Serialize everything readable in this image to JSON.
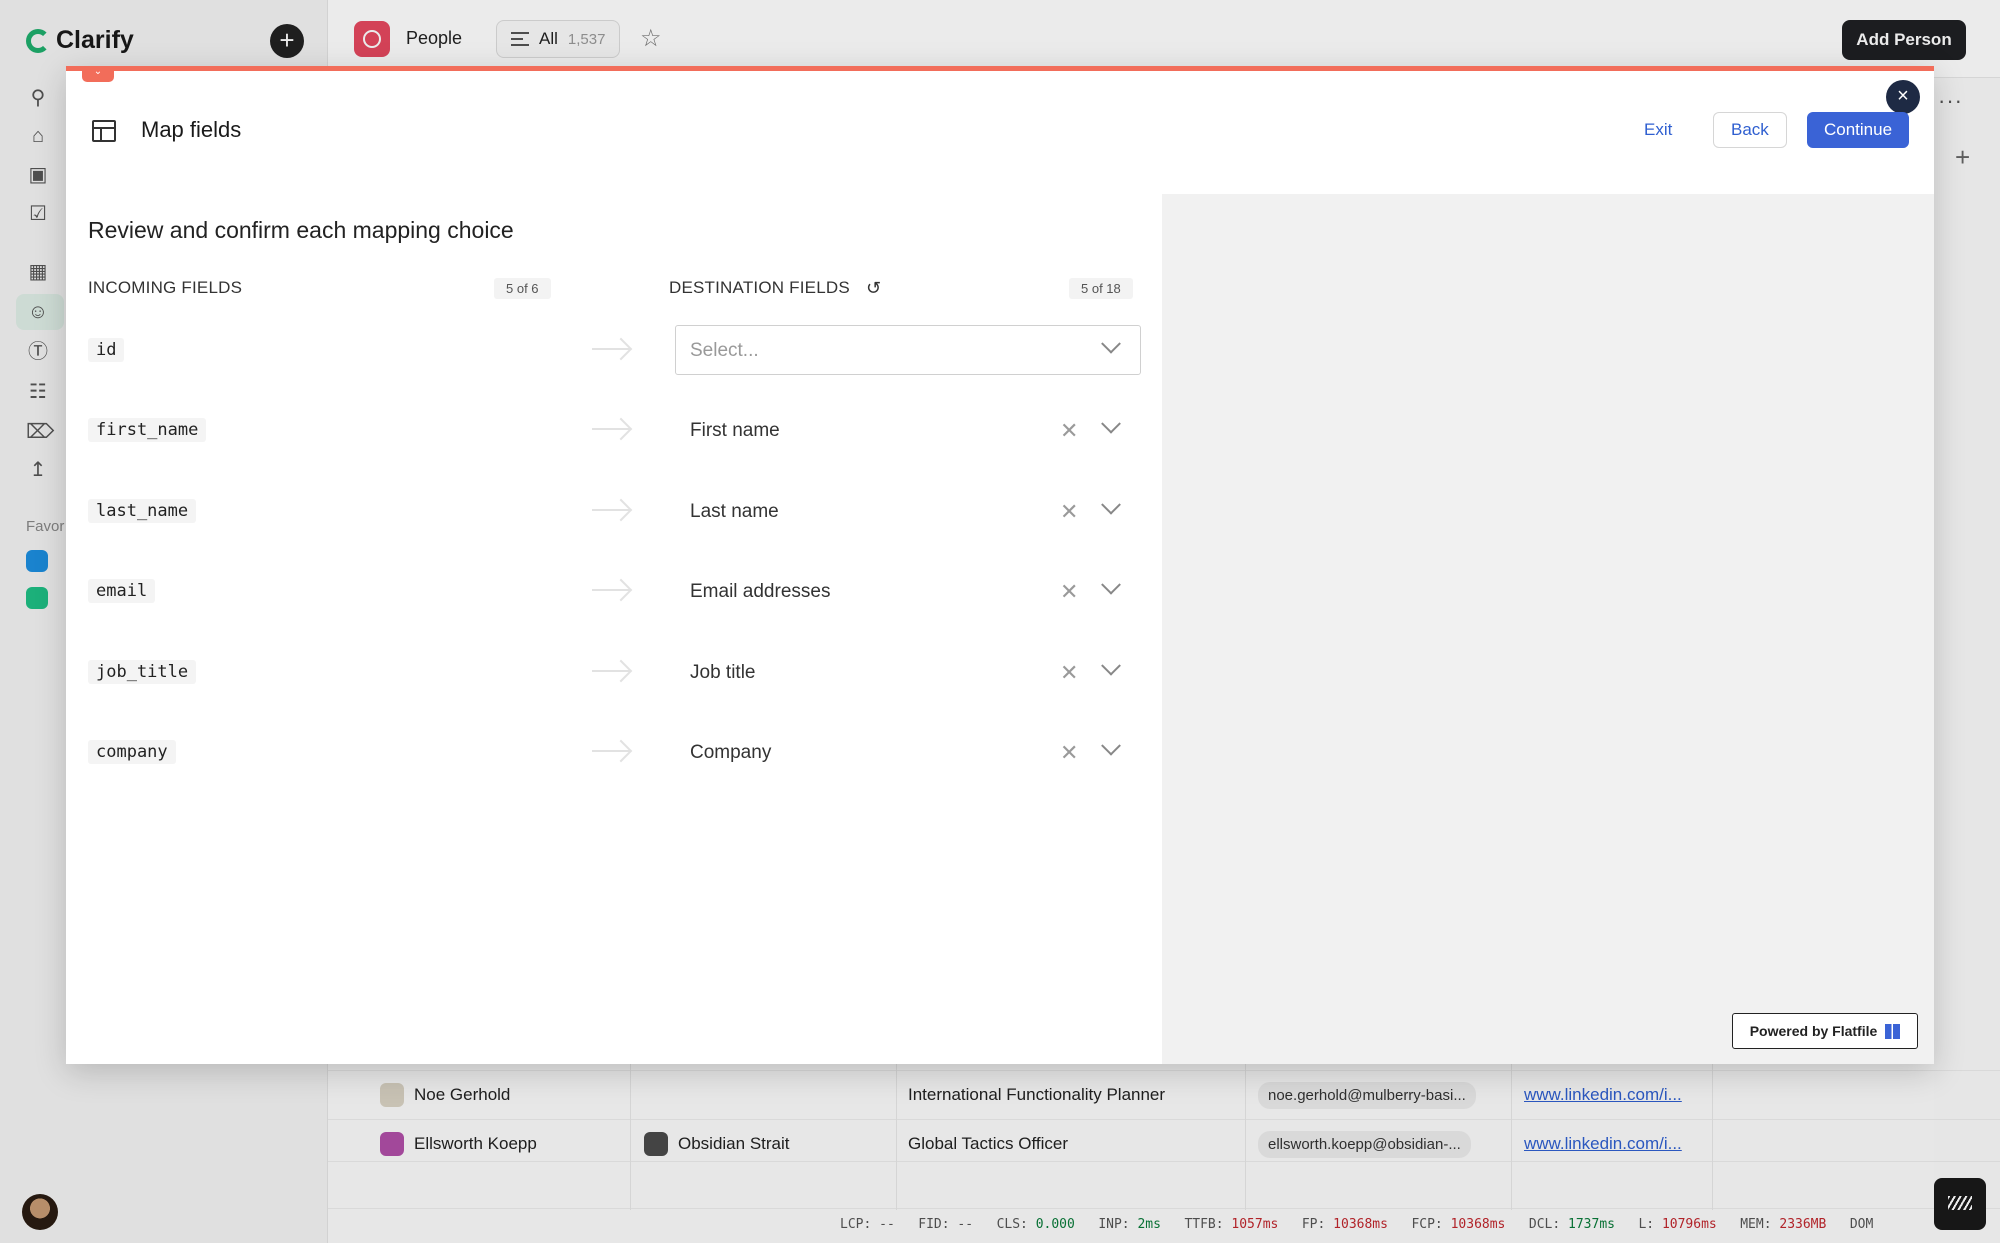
{
  "app": {
    "brand": "Clarify",
    "object_name": "People",
    "view_name": "All",
    "view_count": "1,537",
    "add_button": "Add Person",
    "favorites_label": "Favor"
  },
  "background_rows": [
    {
      "name": "Noe Gerhold",
      "company": "",
      "title": "International Functionality Planner",
      "email": "noe.gerhold@mulberry-basi...",
      "linkedin": "www.linkedin.com/i..."
    },
    {
      "name": "Ellsworth Koepp",
      "company": "Obsidian Strait",
      "title": "Global Tactics Officer",
      "email": "ellsworth.koepp@obsidian-...",
      "linkedin": "www.linkedin.com/i..."
    }
  ],
  "modal": {
    "title": "Map fields",
    "exit_label": "Exit",
    "back_label": "Back",
    "continue_label": "Continue",
    "review_title": "Review and confirm each mapping choice",
    "incoming_header": "INCOMING FIELDS",
    "incoming_count": "5 of 6",
    "destination_header": "DESTINATION FIELDS",
    "destination_count": "5 of 18",
    "powered_by": "Powered by Flatfile",
    "mappings": [
      {
        "incoming": "id",
        "destination": "",
        "placeholder": "Select..."
      },
      {
        "incoming": "first_name",
        "destination": "First name"
      },
      {
        "incoming": "last_name",
        "destination": "Last name"
      },
      {
        "incoming": "email",
        "destination": "Email addresses"
      },
      {
        "incoming": "job_title",
        "destination": "Job title"
      },
      {
        "incoming": "company",
        "destination": "Company"
      }
    ]
  },
  "perf": {
    "lcp_label": "LCP:",
    "lcp": "--",
    "fid_label": "FID:",
    "fid": "--",
    "cls_label": "CLS:",
    "cls": "0.000",
    "inp_label": "INP:",
    "inp": "2ms",
    "ttfb_label": "TTFB:",
    "ttfb": "1057ms",
    "fp_label": "FP:",
    "fp": "10368ms",
    "fcp_label": "FCP:",
    "fcp": "10368ms",
    "dcl_label": "DCL:",
    "dcl": "1737ms",
    "l_label": "L:",
    "l": "10796ms",
    "mem_label": "MEM:",
    "mem": "2336MB",
    "dom_label": "DOM"
  },
  "colors": {
    "accent": "#3a63d6",
    "modal_topline": "#f26d5a",
    "people_icon": "#e5485f",
    "brand_green": "#1fae6d"
  }
}
